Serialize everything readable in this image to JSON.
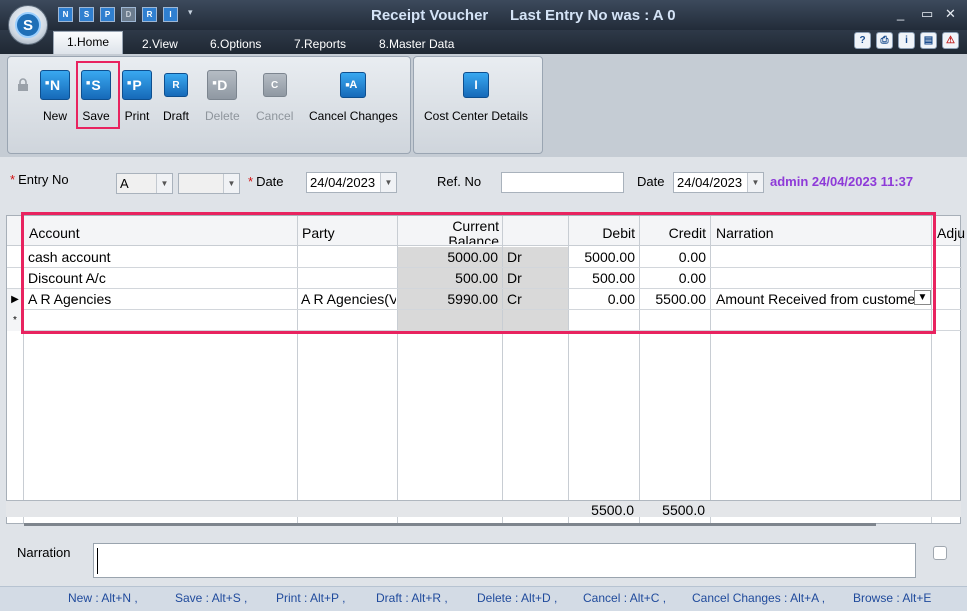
{
  "window": {
    "title": "Receipt Voucher",
    "last_entry": "Last Entry No was : A 0",
    "minimize": "_",
    "maximize": "▭",
    "close": "✕"
  },
  "app_logo": "S",
  "quick_access": [
    "N",
    "S",
    "P",
    "D",
    "R",
    "I"
  ],
  "tabs": [
    {
      "label": "1.Home"
    },
    {
      "label": "2.View"
    },
    {
      "label": "6.Options"
    },
    {
      "label": "7.Reports"
    },
    {
      "label": "8.Master Data"
    }
  ],
  "help_icons": [
    "?",
    "⎙",
    "i",
    "▤",
    "⚠"
  ],
  "ribbon": {
    "buttons": [
      {
        "label": "New",
        "glyph": "N"
      },
      {
        "label": "Save",
        "glyph": "S"
      },
      {
        "label": "Print",
        "glyph": "P"
      },
      {
        "label": "Draft",
        "glyph": "R"
      },
      {
        "label": "Delete",
        "glyph": "D"
      },
      {
        "label": "Cancel",
        "glyph": "C"
      },
      {
        "label": "Cancel Changes",
        "glyph": "A"
      },
      {
        "label": "Cost Center Details",
        "glyph": "I"
      }
    ]
  },
  "form": {
    "entry_no_label": "Entry No",
    "entry_prefix": "A",
    "entry_number": "",
    "date_label": "Date",
    "date_value": "24/04/2023",
    "ref_no_label": "Ref. No",
    "ref_no_value": "",
    "date2_label": "Date",
    "date2_value": "24/04/2023",
    "audit_text": "admin 24/04/2023 11:37",
    "required_mark": "*"
  },
  "grid": {
    "columns": [
      "Account",
      "Party",
      "Current Balance",
      "",
      "Debit",
      "Credit",
      "Narration",
      "Adju"
    ],
    "rows": [
      {
        "account": "cash account",
        "party": "",
        "balance": "5000.00",
        "drcr": "Dr",
        "debit": "5000.00",
        "credit": "0.00",
        "narration": ""
      },
      {
        "account": "Discount A/c",
        "party": "",
        "balance": "500.00",
        "drcr": "Dr",
        "debit": "500.00",
        "credit": "0.00",
        "narration": ""
      },
      {
        "account": "A R Agencies",
        "party": "A R Agencies(V",
        "balance": "5990.00",
        "drcr": "Cr",
        "debit": "0.00",
        "credit": "5500.00",
        "narration": "Amount Received from custome"
      }
    ],
    "current_row_marker": "▶",
    "new_row_marker": "*",
    "dropdown_glyph": "▼",
    "total_debit": "5500.0",
    "total_credit": "5500.0"
  },
  "narration": {
    "label": "Narration",
    "value": ""
  },
  "shortcuts": [
    "New : Alt+N ,",
    "Save : Alt+S ,",
    "Print : Alt+P ,",
    "Draft : Alt+R ,",
    "Delete : Alt+D ,",
    "Cancel : Alt+C ,",
    "Cancel Changes : Alt+A ,",
    "Browse : Alt+E"
  ],
  "colors": {
    "highlight": "#e8235f",
    "audit": "#8e3ad8",
    "shortcut": "#1f4a9c",
    "icon_blue": "#1669b8"
  }
}
